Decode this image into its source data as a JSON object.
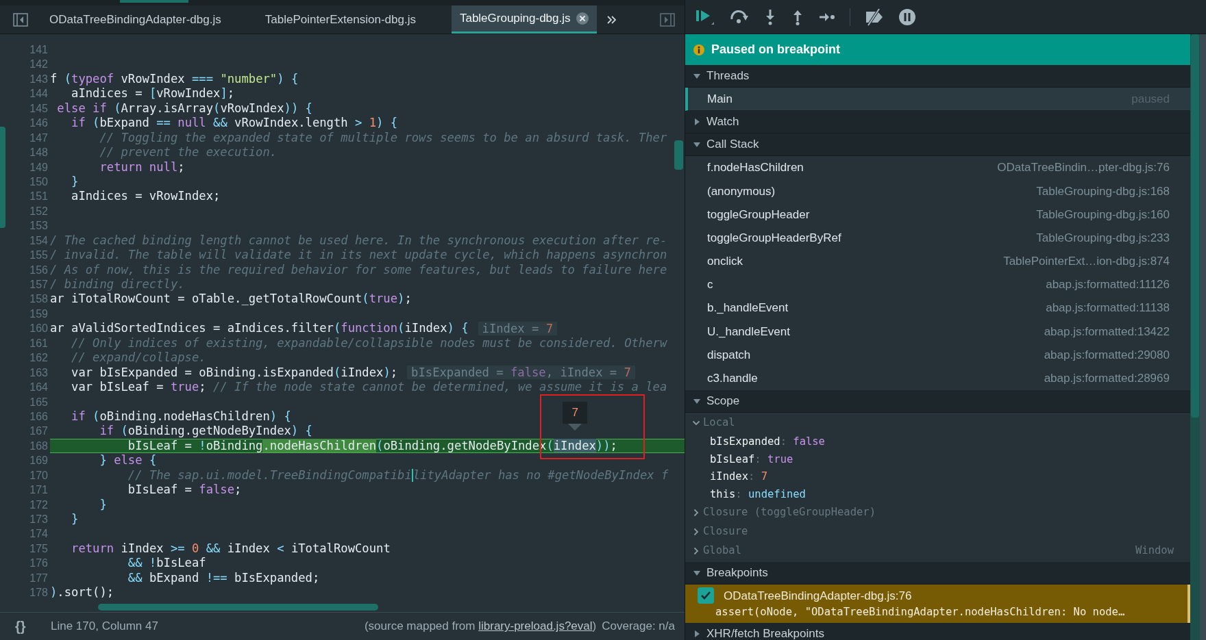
{
  "tabs": [
    {
      "label": "ODataTreeBindingAdapter-dbg.js",
      "selected": false
    },
    {
      "label": "TablePointerExtension-dbg.js",
      "selected": false
    },
    {
      "label": "TableGrouping-dbg.js",
      "selected": true
    }
  ],
  "editor": {
    "lines": [
      {
        "number": "141",
        "current": false
      },
      {
        "number": "142",
        "current": false
      },
      {
        "number": "143",
        "current": false,
        "segments": [
          {
            "kind": "text",
            "text": "f "
          },
          {
            "kind": "punct",
            "text": "("
          },
          {
            "kind": "keyword",
            "text": "typeof"
          },
          {
            "kind": "text",
            "text": " vRowIndex "
          },
          {
            "kind": "punct",
            "text": "=== "
          },
          {
            "kind": "string",
            "text": "\"number\""
          },
          {
            "kind": "punct",
            "text": ") {"
          }
        ]
      },
      {
        "number": "144",
        "current": false,
        "segments": [
          {
            "kind": "text",
            "text": "   aIndices = "
          },
          {
            "kind": "punct",
            "text": "["
          },
          {
            "kind": "text",
            "text": "vRowIndex"
          },
          {
            "kind": "punct",
            "text": "]"
          },
          {
            "kind": "text",
            "text": ";"
          }
        ]
      },
      {
        "number": "145",
        "current": false,
        "segments": [
          {
            "kind": "keyword",
            "text": " else if "
          },
          {
            "kind": "punct",
            "text": "("
          },
          {
            "kind": "text",
            "text": "Array.isArray"
          },
          {
            "kind": "punct",
            "text": "("
          },
          {
            "kind": "text",
            "text": "vRowIndex"
          },
          {
            "kind": "punct",
            "text": ")) {"
          }
        ]
      },
      {
        "number": "146",
        "current": false,
        "segments": [
          {
            "kind": "keyword",
            "text": "   if "
          },
          {
            "kind": "punct",
            "text": "("
          },
          {
            "kind": "text",
            "text": "bExpand "
          },
          {
            "kind": "punct",
            "text": "== "
          },
          {
            "kind": "keyword",
            "text": "null "
          },
          {
            "kind": "punct",
            "text": "&&"
          },
          {
            "kind": "text",
            "text": " vRowIndex.length "
          },
          {
            "kind": "punct",
            "text": "> "
          },
          {
            "kind": "number",
            "text": "1"
          },
          {
            "kind": "punct",
            "text": ") {"
          }
        ]
      },
      {
        "number": "147",
        "current": false,
        "segments": [
          {
            "kind": "comment",
            "text": "       // Toggling the expanded state of multiple rows seems to be an absurd task. Ther"
          }
        ]
      },
      {
        "number": "148",
        "current": false,
        "segments": [
          {
            "kind": "comment",
            "text": "       // prevent the execution."
          }
        ]
      },
      {
        "number": "149",
        "current": false,
        "segments": [
          {
            "kind": "keyword",
            "text": "       return null"
          },
          {
            "kind": "text",
            "text": ";"
          }
        ]
      },
      {
        "number": "150",
        "current": false,
        "segments": [
          {
            "kind": "punct",
            "text": "   }"
          }
        ]
      },
      {
        "number": "151",
        "current": false,
        "segments": [
          {
            "kind": "text",
            "text": "   aIndices = vRowIndex;"
          }
        ]
      },
      {
        "number": "152",
        "current": false
      },
      {
        "number": "153",
        "current": false
      },
      {
        "number": "154",
        "current": false,
        "segments": [
          {
            "kind": "comment",
            "text": "/ The cached binding length cannot be used here. In the synchronous execution after re-"
          }
        ]
      },
      {
        "number": "155",
        "current": false,
        "segments": [
          {
            "kind": "comment",
            "text": "/ invalid. The table will validate it in its next update cycle, which happens asynchron"
          }
        ]
      },
      {
        "number": "156",
        "current": false,
        "segments": [
          {
            "kind": "comment",
            "text": "/ As of now, this is the required behavior for some features, but leads to failure here"
          }
        ]
      },
      {
        "number": "157",
        "current": false,
        "segments": [
          {
            "kind": "comment",
            "text": "/ binding directly."
          }
        ]
      },
      {
        "number": "158",
        "current": false,
        "segments": [
          {
            "kind": "text",
            "text": "ar iTotalRowCount = oTable._getTotalRowCount"
          },
          {
            "kind": "punct",
            "text": "("
          },
          {
            "kind": "keyword",
            "text": "true"
          },
          {
            "kind": "punct",
            "text": ")"
          },
          {
            "kind": "text",
            "text": ";"
          }
        ]
      },
      {
        "number": "159",
        "current": false
      },
      {
        "number": "160",
        "current": false,
        "segments": [
          {
            "kind": "text",
            "text": "ar aValidSortedIndices = aIndices.filter"
          },
          {
            "kind": "punct",
            "text": "("
          },
          {
            "kind": "keyword",
            "text": "function"
          },
          {
            "kind": "punct",
            "text": "("
          },
          {
            "kind": "text",
            "text": "iIndex"
          },
          {
            "kind": "punct",
            "text": ") {"
          }
        ],
        "inline_value": [
          {
            "kind": "text",
            "text": "iIndex = "
          },
          {
            "kind": "number",
            "text": "7"
          }
        ]
      },
      {
        "number": "161",
        "current": false,
        "segments": [
          {
            "kind": "comment",
            "text": "   // Only indices of existing, expandable/collapsible nodes must be considered. Otherw"
          }
        ]
      },
      {
        "number": "162",
        "current": false,
        "segments": [
          {
            "kind": "comment",
            "text": "   // expand/collapse."
          }
        ]
      },
      {
        "number": "163",
        "current": false,
        "segments": [
          {
            "kind": "text",
            "text": "   var bIsExpanded = oBinding.isExpanded"
          },
          {
            "kind": "punct",
            "text": "("
          },
          {
            "kind": "text",
            "text": "iIndex"
          },
          {
            "kind": "punct",
            "text": ")"
          },
          {
            "kind": "text",
            "text": ";"
          }
        ],
        "inline_value": [
          {
            "kind": "text",
            "text": "bIsExpanded = "
          },
          {
            "kind": "keyword",
            "text": "false"
          },
          {
            "kind": "text",
            "text": ", iIndex = "
          },
          {
            "kind": "number",
            "text": "7"
          }
        ]
      },
      {
        "number": "164",
        "current": false,
        "segments": [
          {
            "kind": "text",
            "text": "   var bIsLeaf = "
          },
          {
            "kind": "keyword",
            "text": "true"
          },
          {
            "kind": "text",
            "text": "; "
          },
          {
            "kind": "comment",
            "text": "// If the node state cannot be determined, we assume it is a lea"
          }
        ]
      },
      {
        "number": "165",
        "current": false
      },
      {
        "number": "166",
        "current": false,
        "segments": [
          {
            "kind": "keyword",
            "text": "   if "
          },
          {
            "kind": "punct",
            "text": "("
          },
          {
            "kind": "text",
            "text": "oBinding.nodeHasChildren"
          },
          {
            "kind": "punct",
            "text": ") {"
          }
        ]
      },
      {
        "number": "167",
        "current": false,
        "segments": [
          {
            "kind": "keyword",
            "text": "       if "
          },
          {
            "kind": "punct",
            "text": "("
          },
          {
            "kind": "text",
            "text": "oBinding.getNodeByIndex"
          },
          {
            "kind": "punct",
            "text": ") {"
          }
        ]
      },
      {
        "number": "168",
        "current": true,
        "segments": [
          {
            "kind": "text",
            "text": "           bIsLeaf = "
          },
          {
            "kind": "punct",
            "text": "!"
          },
          {
            "kind": "text",
            "text": "oBinding"
          },
          {
            "kind": "match",
            "text": ".nodeHasChildren"
          },
          {
            "kind": "punct",
            "text": "("
          },
          {
            "kind": "text",
            "text": "oBinding.getNodeByIndex"
          },
          {
            "kind": "punct",
            "text": "("
          },
          {
            "kind": "selection",
            "text": "iIndex"
          },
          {
            "kind": "punct",
            "text": "))"
          },
          {
            "kind": "text",
            "text": ";"
          }
        ]
      },
      {
        "number": "169",
        "current": false,
        "segments": [
          {
            "kind": "punct",
            "text": "       } "
          },
          {
            "kind": "keyword",
            "text": "else"
          },
          {
            "kind": "punct",
            "text": " {"
          }
        ]
      },
      {
        "number": "170",
        "current": false,
        "caret": true,
        "segments": [
          {
            "kind": "comment",
            "text": "           // The sap.ui.model.TreeBindingCompatibi"
          },
          {
            "kind": "comment",
            "text": "lityAdapter has no #getNodeByIndex f"
          }
        ]
      },
      {
        "number": "171",
        "current": false,
        "segments": [
          {
            "kind": "text",
            "text": "           bIsLeaf = "
          },
          {
            "kind": "keyword",
            "text": "false"
          },
          {
            "kind": "text",
            "text": ";"
          }
        ]
      },
      {
        "number": "172",
        "current": false,
        "segments": [
          {
            "kind": "punct",
            "text": "       }"
          }
        ]
      },
      {
        "number": "173",
        "current": false,
        "segments": [
          {
            "kind": "punct",
            "text": "   }"
          }
        ]
      },
      {
        "number": "174",
        "current": false
      },
      {
        "number": "175",
        "current": false,
        "segments": [
          {
            "kind": "keyword",
            "text": "   return "
          },
          {
            "kind": "text",
            "text": "iIndex "
          },
          {
            "kind": "punct",
            "text": ">= "
          },
          {
            "kind": "number",
            "text": "0 "
          },
          {
            "kind": "punct",
            "text": "&&"
          },
          {
            "kind": "text",
            "text": " iIndex "
          },
          {
            "kind": "punct",
            "text": "<"
          },
          {
            "kind": "text",
            "text": " iTotalRowCount"
          }
        ]
      },
      {
        "number": "176",
        "current": false,
        "segments": [
          {
            "kind": "punct",
            "text": "           && !"
          },
          {
            "kind": "text",
            "text": "bIsLeaf"
          }
        ]
      },
      {
        "number": "177",
        "current": false,
        "segments": [
          {
            "kind": "punct",
            "text": "           &&"
          },
          {
            "kind": "text",
            "text": " bExpand "
          },
          {
            "kind": "punct",
            "text": "!=="
          },
          {
            "kind": "text",
            "text": " bIsExpanded;"
          }
        ]
      },
      {
        "number": "178",
        "current": false,
        "segments": [
          {
            "kind": "punct",
            "text": ")"
          },
          {
            "kind": "text",
            "text": ".sort();"
          }
        ]
      }
    ],
    "hover_value": "7",
    "annotation_frame": true
  },
  "status_bar": {
    "pretty_print": "{}",
    "position": "Line 170, Column 47",
    "source_prefix": "(source mapped from ",
    "source_link": "library-preload.js?eval",
    "source_suffix": ")",
    "coverage": "Coverage: n/a"
  },
  "banner": "Paused on breakpoint",
  "sections": [
    {
      "title": "Threads",
      "expanded": true,
      "kind": "threads",
      "items": [
        {
          "name": "Main",
          "status": "paused",
          "selected": true
        }
      ]
    },
    {
      "title": "Watch",
      "expanded": false
    },
    {
      "title": "Call Stack",
      "expanded": true,
      "kind": "frames",
      "items": [
        {
          "name": "f.nodeHasChildren",
          "location": "ODataTreeBindin…pter-dbg.js:76"
        },
        {
          "name": "(anonymous)",
          "location": "TableGrouping-dbg.js:168"
        },
        {
          "name": "toggleGroupHeader",
          "location": "TableGrouping-dbg.js:160"
        },
        {
          "name": "toggleGroupHeaderByRef",
          "location": "TableGrouping-dbg.js:233"
        },
        {
          "name": "onclick",
          "location": "TablePointerExt…ion-dbg.js:874"
        },
        {
          "name": "c",
          "location": "abap.js:formatted:11126"
        },
        {
          "name": "b._handleEvent",
          "location": "abap.js:formatted:11138"
        },
        {
          "name": "U._handleEvent",
          "location": "abap.js:formatted:13422"
        },
        {
          "name": "dispatch",
          "location": "abap.js:formatted:29080"
        },
        {
          "name": "c3.handle",
          "location": "abap.js:formatted:28969"
        }
      ]
    },
    {
      "title": "Scope",
      "expanded": true,
      "kind": "scope",
      "groups": [
        {
          "name": "Local",
          "expanded": true,
          "vars": [
            {
              "name": "bIsExpanded",
              "separator": ":",
              "value": "false",
              "kind": "boolean"
            },
            {
              "name": "bIsLeaf",
              "separator": ":",
              "value": "true",
              "kind": "boolean"
            },
            {
              "name": "iIndex",
              "separator": ":",
              "value": "7",
              "kind": "number"
            },
            {
              "name": "this",
              "separator": ":",
              "value": "undefined",
              "kind": "undefined"
            }
          ]
        },
        {
          "name": "Closure (toggleGroupHeader)",
          "expanded": false
        },
        {
          "name": "Closure",
          "expanded": false
        },
        {
          "name": "Global",
          "expanded": false,
          "value": "Window"
        }
      ]
    },
    {
      "title": "Breakpoints",
      "expanded": true,
      "kind": "breakpoints",
      "items": [
        {
          "file": "ODataTreeBindingAdapter-dbg.js:76",
          "code": "assert(oNode, \"ODataTreeBindingAdapter.nodeHasChildren: No node…",
          "checked": true,
          "active": true
        }
      ]
    },
    {
      "title": "XHR/fetch Breakpoints",
      "expanded": false
    }
  ]
}
